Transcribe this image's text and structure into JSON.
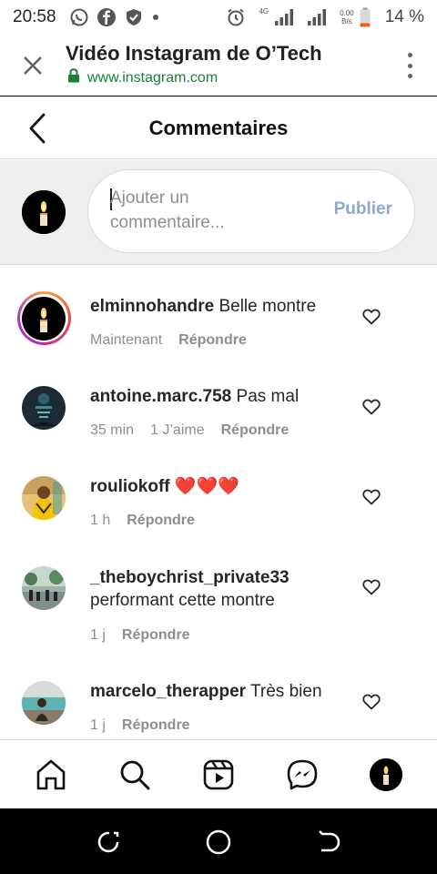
{
  "status_bar": {
    "time": "20:58",
    "left_icons": [
      "whatsapp-icon",
      "facebook-icon",
      "shield-icon",
      "dot-icon"
    ],
    "network_label": "4G",
    "speed_value": "0.00",
    "speed_unit": "B/s",
    "battery_text": "14 %"
  },
  "browser": {
    "title": "Vidéo Instagram de O’Tech",
    "url": "www.instagram.com",
    "url_color": "#188038"
  },
  "header": {
    "title": "Commentaires"
  },
  "composer": {
    "placeholder": "Ajouter un commentaire...",
    "publish_label": "Publier"
  },
  "comments": [
    {
      "username": "elminnohandre",
      "text": "Belle montre",
      "time": "Maintenant",
      "likes": "",
      "reply_label": "Répondre",
      "has_story": true
    },
    {
      "username": "antoine.marc.758",
      "text": "Pas mal",
      "time": "35 min",
      "likes": "1 J’aime",
      "reply_label": "Répondre",
      "has_story": false
    },
    {
      "username": "rouliokoff",
      "text": "❤️❤️❤️",
      "time": "1 h",
      "likes": "",
      "reply_label": "Répondre",
      "has_story": false
    },
    {
      "username": "_theboychrist_private33",
      "text": "performant cette montre",
      "time": "1 j",
      "likes": "",
      "reply_label": "Répondre",
      "has_story": false
    },
    {
      "username": "marcelo_therapper",
      "text": "Très bien",
      "time": "1 j",
      "likes": "",
      "reply_label": "Répondre",
      "has_story": false
    }
  ],
  "bottom_nav": {
    "items": [
      "home-icon",
      "search-icon",
      "reels-icon",
      "messenger-icon",
      "profile-avatar"
    ]
  },
  "android_nav": {
    "items": [
      "recent-apps-icon",
      "home-circle-icon",
      "back-icon"
    ]
  },
  "colors": {
    "accent_blue_disabled": "#8fa9cc",
    "secondary_text": "#8e8e8e",
    "composer_bg": "#efefef"
  }
}
